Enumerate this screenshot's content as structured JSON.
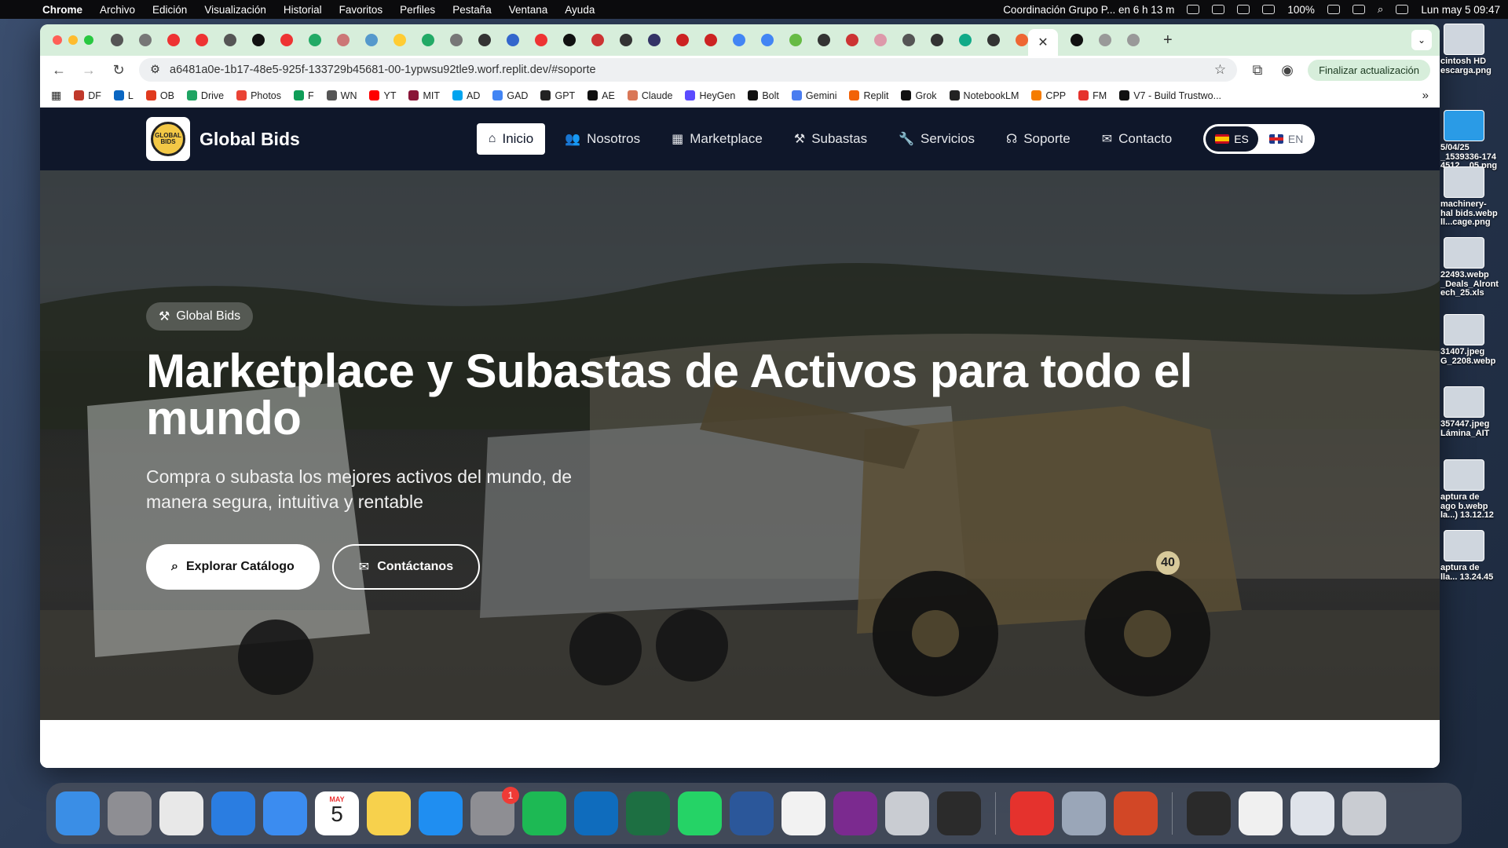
{
  "menubar": {
    "app": "Chrome",
    "items": [
      "Archivo",
      "Edición",
      "Visualización",
      "Historial",
      "Favoritos",
      "Perfiles",
      "Pestaña",
      "Ventana",
      "Ayuda"
    ],
    "event": "Coordinación Grupo P... en 6 h 13 m",
    "battery": "100%",
    "datetime": "Lun may 5  09:47"
  },
  "browser": {
    "url": "a6481a0e-1b17-48e5-925f-133729b45681-00-1ypwsu92tle9.worf.replit.dev/#soporte",
    "update_label": "Finalizar actualización",
    "active_tab_icon": "close-icon",
    "bookmarks": [
      {
        "label": "DF",
        "color": "#c0392b"
      },
      {
        "label": "L",
        "color": "#0a66c2"
      },
      {
        "label": "OB",
        "color": "#e03a1e"
      },
      {
        "label": "Drive",
        "color": "#1fa463"
      },
      {
        "label": "Photos",
        "color": "#ea4335"
      },
      {
        "label": "F",
        "color": "#0f9d58"
      },
      {
        "label": "WN",
        "color": "#555555"
      },
      {
        "label": "YT",
        "color": "#ff0000"
      },
      {
        "label": "MIT",
        "color": "#8a1538"
      },
      {
        "label": "AD",
        "color": "#00a4ef"
      },
      {
        "label": "GAD",
        "color": "#4285f4"
      },
      {
        "label": "GPT",
        "color": "#222222"
      },
      {
        "label": "AE",
        "color": "#111111"
      },
      {
        "label": "Claude",
        "color": "#d97757"
      },
      {
        "label": "HeyGen",
        "color": "#5b4bff"
      },
      {
        "label": "Bolt",
        "color": "#111111"
      },
      {
        "label": "Gemini",
        "color": "#4a7df0"
      },
      {
        "label": "Replit",
        "color": "#f26207"
      },
      {
        "label": "Grok",
        "color": "#111111"
      },
      {
        "label": "NotebookLM",
        "color": "#222222"
      },
      {
        "label": "CPP",
        "color": "#f57c00"
      },
      {
        "label": "FM",
        "color": "#e5322d"
      },
      {
        "label": "V7 - Build Trustwo...",
        "color": "#111111"
      }
    ]
  },
  "site": {
    "brand": "Global Bids",
    "logo_text": "GLOBAL BIDS",
    "nav": [
      {
        "label": "Inicio",
        "icon": "home-icon",
        "glyph": "⌂",
        "active": true
      },
      {
        "label": "Nosotros",
        "icon": "users-icon",
        "glyph": "👥",
        "active": false
      },
      {
        "label": "Marketplace",
        "icon": "grid-icon",
        "glyph": "▦",
        "active": false
      },
      {
        "label": "Subastas",
        "icon": "gavel-icon",
        "glyph": "⚒",
        "active": false
      },
      {
        "label": "Servicios",
        "icon": "wrench-icon",
        "glyph": "🔧",
        "active": false
      },
      {
        "label": "Soporte",
        "icon": "headset-icon",
        "glyph": "☊",
        "active": false
      },
      {
        "label": "Contacto",
        "icon": "envelope-icon",
        "glyph": "✉",
        "active": false
      }
    ],
    "lang": {
      "es": "ES",
      "en": "EN",
      "selected": "ES"
    },
    "hero": {
      "pill": "Global Bids",
      "title": "Marketplace y Subastas de Activos para todo el mundo",
      "subtitle": "Compra o subasta los mejores activos del mundo, de manera segura, intuitiva y rentable",
      "primary_btn": "Explorar Catálogo",
      "secondary_btn": "Contáctanos",
      "truck_number": "40"
    }
  },
  "desktop_files": [
    {
      "name": "cintosh HD\nescarga.png",
      "kind": "drive"
    },
    {
      "name": "5/04/25\n_1539336-174\n4512....05.png",
      "kind": "folder"
    },
    {
      "name": "machinery-\nhal bids.webp\nll...cage.png",
      "kind": "image"
    },
    {
      "name": "22493.webp\n_Deals_Alront\nech_25.xls",
      "kind": "image"
    },
    {
      "name": "31407.jpeg\nG_2208.webp",
      "kind": "image"
    },
    {
      "name": "357447.jpeg\nLámina_AIT",
      "kind": "image"
    },
    {
      "name": "aptura de\nago b.webp\nla...) 13.12.12",
      "kind": "image"
    },
    {
      "name": "aptura de\nlla... 13.24.45",
      "kind": "image"
    }
  ],
  "dock": {
    "calendar_month": "MAY",
    "calendar_day": "5",
    "settings_badge": "1",
    "apps": [
      {
        "name": "finder-icon",
        "color": "#3a8ee6"
      },
      {
        "name": "launchpad-icon",
        "color": "#8e8e93"
      },
      {
        "name": "chrome-icon",
        "color": "#e8e8e8"
      },
      {
        "name": "safari-icon",
        "color": "#2a7de1"
      },
      {
        "name": "mail-icon",
        "color": "#3b8cf0"
      },
      {
        "name": "calendar-icon",
        "color": "#ffffff"
      },
      {
        "name": "notes-icon",
        "color": "#f7d14c"
      },
      {
        "name": "keynote-icon",
        "color": "#1f8ef1"
      },
      {
        "name": "settings-icon",
        "color": "#8e8e93"
      },
      {
        "name": "spotify-icon",
        "color": "#1db954"
      },
      {
        "name": "outlook-icon",
        "color": "#0f6cbd"
      },
      {
        "name": "excel-icon",
        "color": "#1d6f42"
      },
      {
        "name": "whatsapp-icon",
        "color": "#25d366"
      },
      {
        "name": "word-icon",
        "color": "#2b579a"
      },
      {
        "name": "onefive-icon",
        "color": "#f2f2f2"
      },
      {
        "name": "circle-app-icon",
        "color": "#7b2a8f"
      },
      {
        "name": "pen-app-icon",
        "color": "#c9ccd2"
      },
      {
        "name": "figma-icon",
        "color": "#2b2b2b"
      },
      {
        "name": "acrobat-icon",
        "color": "#e5322d"
      },
      {
        "name": "preview-icon",
        "color": "#9aa6b8"
      },
      {
        "name": "powerpoint-icon",
        "color": "#d24726"
      },
      {
        "name": "recent-file-1-icon",
        "color": "#2a2a2a"
      },
      {
        "name": "recent-file-2-icon",
        "color": "#f0f0f0"
      },
      {
        "name": "downloads-stack-icon",
        "color": "#dfe3ea"
      },
      {
        "name": "trash-icon",
        "color": "#c9ccd2"
      }
    ]
  }
}
